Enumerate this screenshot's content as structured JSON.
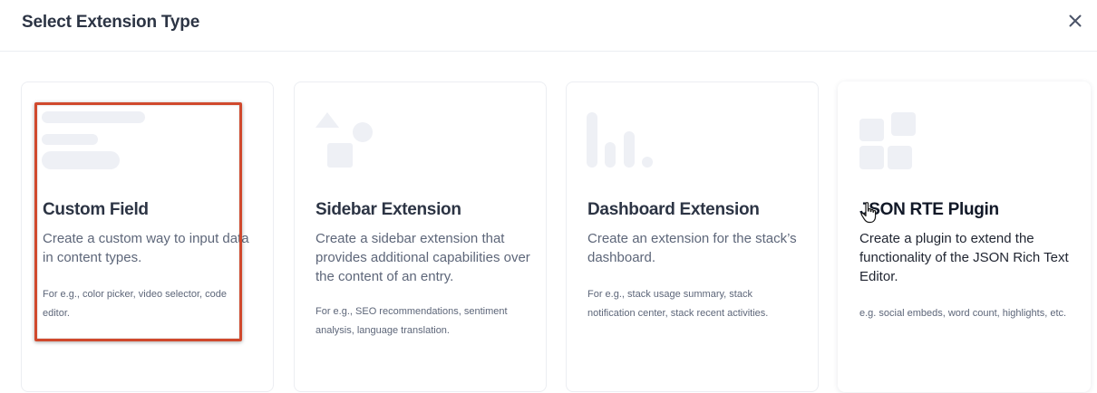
{
  "modal": {
    "title": "Select Extension Type",
    "close_icon": "close-icon"
  },
  "cards": [
    {
      "title": "Custom Field",
      "description": "Create a custom way to input data in content types.",
      "example": "For e.g., color picker, video selector, code editor.",
      "illustration": "text-lines-icon"
    },
    {
      "title": "Sidebar Extension",
      "description": "Create a sidebar extension that provides additional capabilities over the content of an entry.",
      "example": "For e.g., SEO recommendations, sentiment analysis, language translation.",
      "illustration": "shapes-icon"
    },
    {
      "title": "Dashboard Extension",
      "description": "Create an extension for the stack’s dashboard.",
      "example": "For e.g., stack usage summary, stack notification center, stack recent activities.",
      "illustration": "bar-chart-icon"
    },
    {
      "title": "JSON RTE Plugin",
      "description": "Create a plugin to extend the functionality of the JSON Rich Text Editor.",
      "example": "e.g. social embeds, word count, highlights, etc.",
      "illustration": "blocks-icon"
    }
  ],
  "colors": {
    "illustration": "#eef0f5",
    "highlight": "#d0492d",
    "title": "#2c3444",
    "muted_text": "#5d6679"
  }
}
